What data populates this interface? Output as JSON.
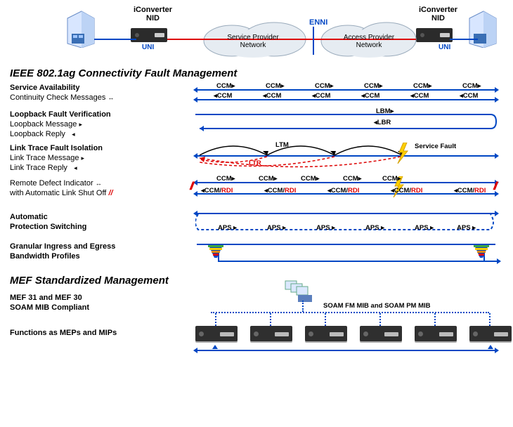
{
  "topology": {
    "left_device": "iConverter\nNID",
    "right_device": "iConverter\nNID",
    "uni_left": "UNI",
    "uni_right": "UNI",
    "enni": "ENNI",
    "cloud_left": "Service Provider\nNetwork",
    "cloud_right": "Access Provider\nNetwork"
  },
  "section1_title": "IEEE 802.1ag  Connectivity Fault Management",
  "service_availability": {
    "heading": "Service Availability",
    "sub": "Continuity Check Messages",
    "arrows": "↔",
    "ccm": "CCM",
    "ccm_right": "CCM▸",
    "ccm_left": "◂CCM"
  },
  "loopback": {
    "heading": "Loopback Fault Verification",
    "sub1": "Loopback Message",
    "arr1": "▸",
    "sub2": "Loopback Reply",
    "arr2": "◂",
    "lbm": "LBM▸",
    "lbr": "◂LBR"
  },
  "linktrace": {
    "heading": "Link Trace Fault Isolation",
    "sub1": "Link Trace Message",
    "arr1": "▸",
    "sub2": "Link Trace Reply",
    "arr2": "◂",
    "ltm": "LTM",
    "ltr": "LTR",
    "fault": "Service Fault"
  },
  "rdi": {
    "heading": "Remote Defect Indicator",
    "arrbi": "↔",
    "sub": "with Automatic Link Shut Off",
    "slash": "//",
    "ccm": "CCM▸",
    "ccmrdi_a": "◂CCM/",
    "ccmrdi_b": "RDI"
  },
  "aps": {
    "heading": "Automatic\nProtection Switching",
    "aps": "APS ▸"
  },
  "bw": {
    "heading": "Granular Ingress and Egress\nBandwidth Profiles"
  },
  "section2_title": "MEF Standardized Management",
  "mef": {
    "heading": "MEF 31 and MEF 30\nSOAM MIB Compliant",
    "mib": "SOAM FM MIB and SOAM PM MIB"
  },
  "meps": {
    "heading": "Functions as MEPs and MIPs"
  }
}
